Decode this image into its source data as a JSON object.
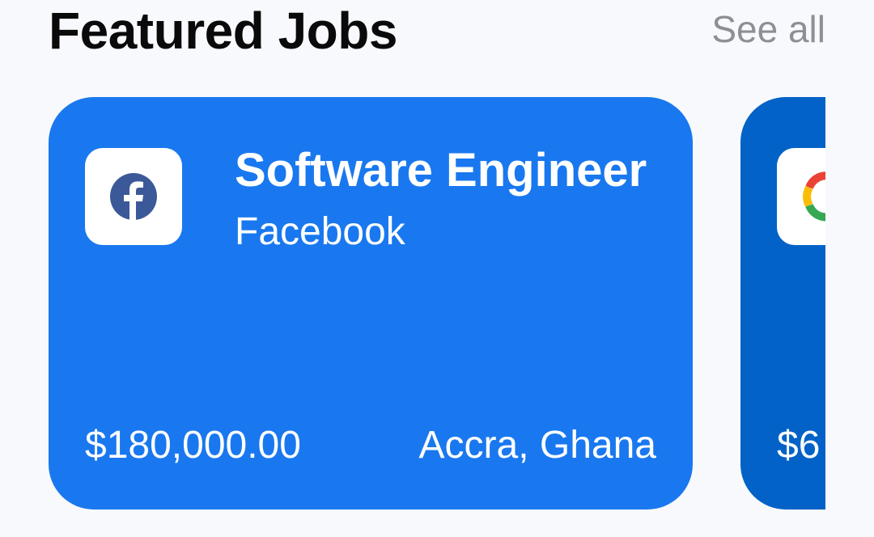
{
  "header": {
    "title": "Featured Jobs",
    "see_all_label": "See all"
  },
  "jobs": [
    {
      "title": "Software Engineer",
      "company": "Facebook",
      "salary": "$180,000.00",
      "location": "Accra, Ghana",
      "logo_icon": "facebook-logo-icon",
      "card_color": "#1978ef"
    },
    {
      "salary": "$6",
      "logo_icon": "google-logo-icon",
      "card_color": "#0262c7"
    }
  ],
  "colors": {
    "background": "#f8f9fc",
    "title_text": "#0a0a0a",
    "see_all_text": "#8e8f96",
    "facebook_blue": "#3b5998"
  }
}
